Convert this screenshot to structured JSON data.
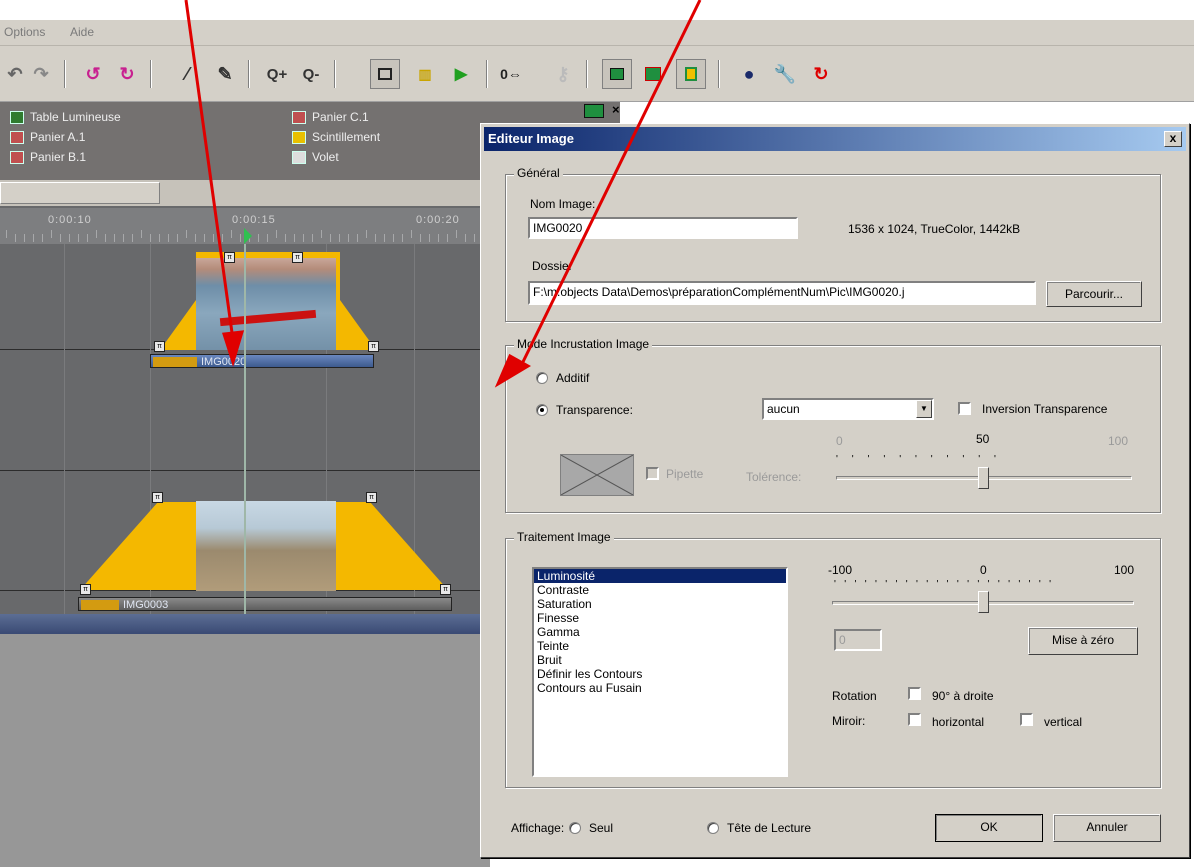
{
  "menu": {
    "items": [
      "Options",
      "Aide"
    ]
  },
  "toolbar": {
    "icons": [
      "undo-icon",
      "redo-icon",
      "rotate-left-icon",
      "rotate-right-icon",
      "magic-wand-icon",
      "pen-icon",
      "zoom-in-icon",
      "zoom-out-icon",
      "select-icon",
      "grid-icon",
      "play-icon",
      "counter-icon",
      "key-icon",
      "screen-icon",
      "tree-icon",
      "panel-icon",
      "nodes-icon",
      "wrench-icon",
      "loop-icon"
    ],
    "zoom_in": "Q+",
    "zoom_out": "Q-",
    "counter": "0⇔"
  },
  "library": {
    "items": [
      "Table Lumineuse",
      "Panier A.1",
      "Panier B.1",
      "Panier C.1",
      "Scintillement",
      "Volet"
    ]
  },
  "timeline": {
    "ruler": [
      "0:00:10",
      "0:00:15",
      "0:00:20"
    ],
    "clips": [
      {
        "name": "IMG0020"
      },
      {
        "name": "IMG0003"
      }
    ]
  },
  "dialog": {
    "title": "Editeur Image",
    "close": "x",
    "general": {
      "label": "Général",
      "name_label": "Nom Image:",
      "name_value": "IMG0020",
      "info": "1536 x 1024, TrueColor, 1442kB",
      "folder_label": "Dossier",
      "folder_value": "F:\\m.objects Data\\Demos\\préparationComplémentNum\\Pic\\IMG0020.j",
      "browse": "Parcourir..."
    },
    "mode": {
      "label": "Mode Incrustation Image",
      "additive": "Additif",
      "transparency": "Transparence:",
      "transparency_value": "aucun",
      "invert": "Inversion Transparence",
      "scale_min": "0",
      "scale_mid": "50",
      "scale_max": "100",
      "pipette": "Pipette",
      "tolerance": "Tolérence:"
    },
    "processing": {
      "label": "Traitement Image",
      "options": [
        "Luminosité",
        "Contraste",
        "Saturation",
        "Finesse",
        "Gamma",
        "Teinte",
        "Bruit",
        "Définir les Contours",
        "Contours au Fusain"
      ],
      "selected": "Luminosité",
      "scale_min": "-100",
      "scale_mid": "0",
      "scale_max": "100",
      "value": "0",
      "reset": "Mise à zéro",
      "rotation_label": "Rotation",
      "rotation_opt": "90° à droite",
      "mirror_label": "Miroir:",
      "mirror_h": "horizontal",
      "mirror_v": "vertical"
    },
    "display": {
      "label": "Affichage:",
      "alone": "Seul",
      "playhead": "Tête de Lecture"
    },
    "ok": "OK",
    "cancel": "Annuler"
  },
  "colors": {
    "arrow": "#e00000",
    "title_start": "#0a246a",
    "title_end": "#a6caf0",
    "envelope": "#f4b800"
  }
}
